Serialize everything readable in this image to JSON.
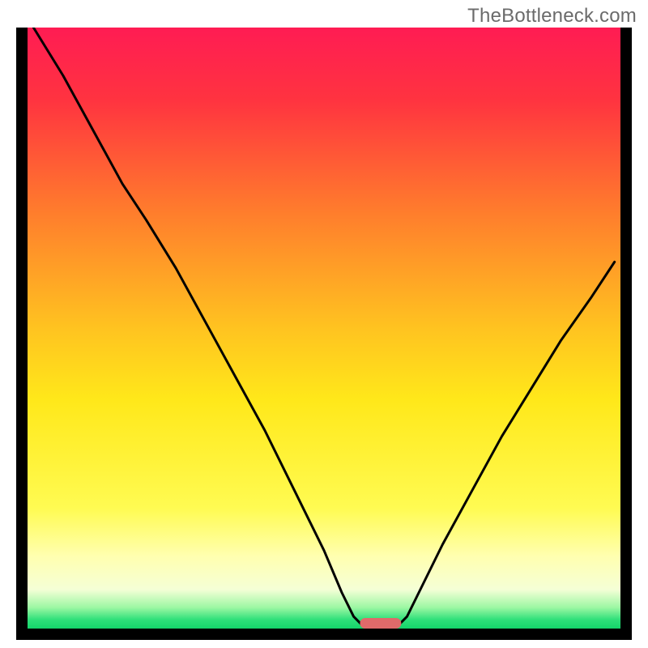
{
  "watermark": "TheBottleneck.com",
  "chart_data": {
    "type": "line",
    "title": "",
    "xlabel": "",
    "ylabel": "",
    "xlim": [
      0,
      100
    ],
    "ylim": [
      0,
      100
    ],
    "grid": false,
    "legend": false,
    "background_gradient_stops": [
      {
        "offset": 0,
        "color": "#ff1c53"
      },
      {
        "offset": 0.12,
        "color": "#ff3340"
      },
      {
        "offset": 0.3,
        "color": "#ff7a2d"
      },
      {
        "offset": 0.5,
        "color": "#ffc320"
      },
      {
        "offset": 0.62,
        "color": "#ffe81a"
      },
      {
        "offset": 0.8,
        "color": "#fffb52"
      },
      {
        "offset": 0.88,
        "color": "#ffffb0"
      },
      {
        "offset": 0.935,
        "color": "#f5ffd6"
      },
      {
        "offset": 0.965,
        "color": "#9cf7a3"
      },
      {
        "offset": 0.985,
        "color": "#2fe07a"
      },
      {
        "offset": 1.0,
        "color": "#14d46a"
      }
    ],
    "series": [
      {
        "name": "curve",
        "stroke": "#000000",
        "stroke_width": 3,
        "points": [
          {
            "x": 1,
            "y": 100
          },
          {
            "x": 6,
            "y": 92
          },
          {
            "x": 11,
            "y": 83
          },
          {
            "x": 16,
            "y": 74
          },
          {
            "x": 20,
            "y": 68
          },
          {
            "x": 25,
            "y": 60
          },
          {
            "x": 30,
            "y": 51
          },
          {
            "x": 35,
            "y": 42
          },
          {
            "x": 40,
            "y": 33
          },
          {
            "x": 45,
            "y": 23
          },
          {
            "x": 50,
            "y": 13
          },
          {
            "x": 53,
            "y": 6
          },
          {
            "x": 55,
            "y": 2
          },
          {
            "x": 56.5,
            "y": 0.5
          },
          {
            "x": 59,
            "y": 0.2
          },
          {
            "x": 62.5,
            "y": 0.5
          },
          {
            "x": 64,
            "y": 2
          },
          {
            "x": 66,
            "y": 6
          },
          {
            "x": 70,
            "y": 14
          },
          {
            "x": 75,
            "y": 23
          },
          {
            "x": 80,
            "y": 32
          },
          {
            "x": 85,
            "y": 40
          },
          {
            "x": 90,
            "y": 48
          },
          {
            "x": 95,
            "y": 55
          },
          {
            "x": 99,
            "y": 61
          }
        ]
      }
    ],
    "marker": {
      "x_center": 59.5,
      "x_width": 7,
      "color": "#e06a6a"
    }
  }
}
